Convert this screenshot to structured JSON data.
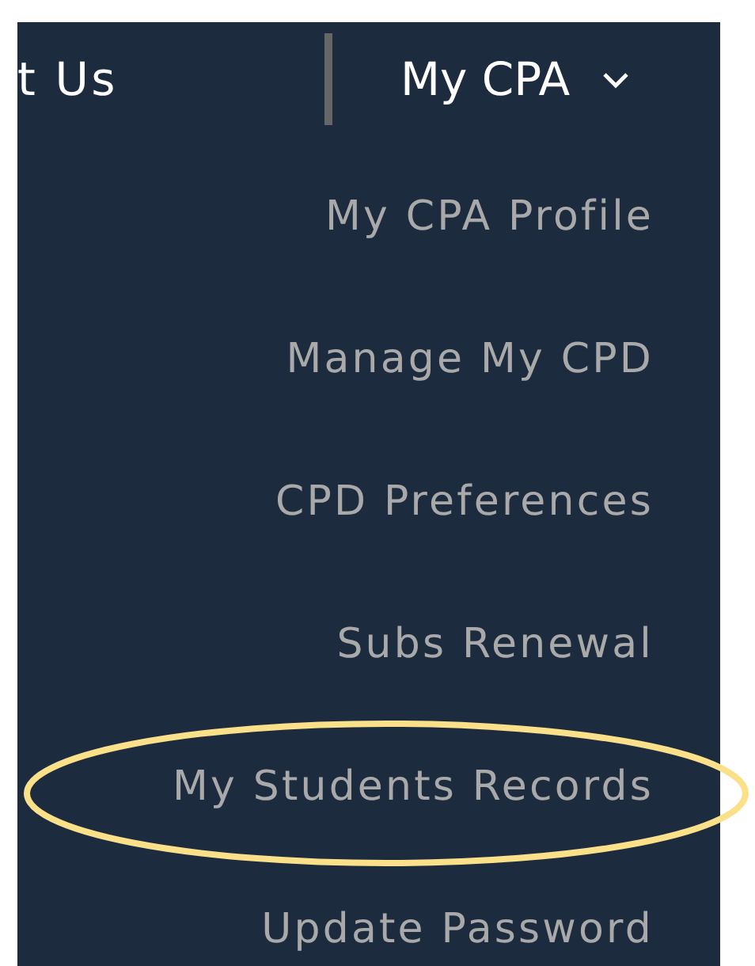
{
  "top_nav": {
    "left_link": "t Us",
    "menu": {
      "label": "My CPA",
      "expanded": true
    }
  },
  "dropdown": {
    "items": [
      {
        "label": "My CPA Profile",
        "highlighted": false
      },
      {
        "label": "Manage My CPD",
        "highlighted": false
      },
      {
        "label": "CPD Preferences",
        "highlighted": false
      },
      {
        "label": "Subs Renewal",
        "highlighted": false
      },
      {
        "label": "My Students Records",
        "highlighted": true
      },
      {
        "label": "Update Password",
        "highlighted": false
      }
    ]
  }
}
